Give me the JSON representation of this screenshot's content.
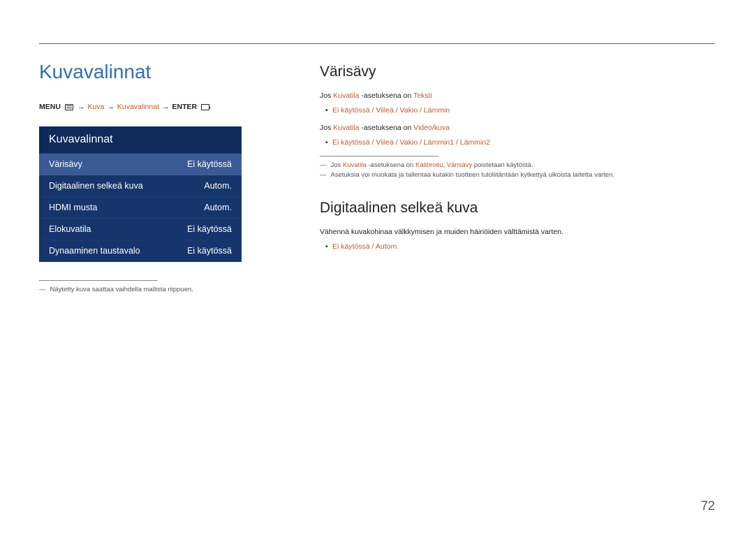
{
  "page_title": "Kuvavalinnat",
  "breadcrumb": {
    "menu_label": "MENU",
    "item1": "Kuva",
    "item2": "Kuvavalinnat",
    "enter_label": "ENTER"
  },
  "menu_panel": {
    "header": "Kuvavalinnat",
    "rows": [
      {
        "label": "Värisävy",
        "value": "Ei käytössä",
        "selected": true
      },
      {
        "label": "Digitaalinen selkeä kuva",
        "value": "Autom.",
        "selected": false
      },
      {
        "label": "HDMI musta",
        "value": "Autom.",
        "selected": false
      },
      {
        "label": "Elokuvatila",
        "value": "Ei käytössä",
        "selected": false
      },
      {
        "label": "Dynaaminen taustavalo",
        "value": "Ei käytössä",
        "selected": false
      }
    ]
  },
  "left_footnote": "Näytetty kuva saattaa vaihdella mallista riippuen.",
  "section_varisavy": {
    "title": "Värisävy",
    "line1_pre": "Jos ",
    "line1_accent": "Kuvatila",
    "line1_mid": " -asetuksena on ",
    "line1_accent2": "Teksti",
    "bullets1": "Ei käytössä / Viileä / Vakio / Lämmin",
    "line2_pre": "Jos ",
    "line2_accent": "Kuvatila",
    "line2_mid": " -asetuksena on ",
    "line2_accent2": "Video/kuva",
    "bullets2": "Ei käytössä / Viileä / Vakio / Lämmin1 / Lämmin2",
    "note1_pre": "Jos ",
    "note1_a1": "Kuvatila",
    "note1_mid1": " -asetuksena on ",
    "note1_a2": "Kalibroitu",
    "note1_mid2": ", ",
    "note1_a3": "Värisävy",
    "note1_end": " poistetaan käytöstä.",
    "note2": "Asetuksia voi muokata ja tallentaa kutakin tuotteen tuloliitäntään kytkettyä ulkoista laitetta varten."
  },
  "section_digi": {
    "title": "Digitaalinen selkeä kuva",
    "line": "Vähennä kuvakohinaa välkkymisen ja muiden häiriöiden välttämistä varten.",
    "bullets": "Ei käytössä / Autom."
  },
  "page_number": "72"
}
